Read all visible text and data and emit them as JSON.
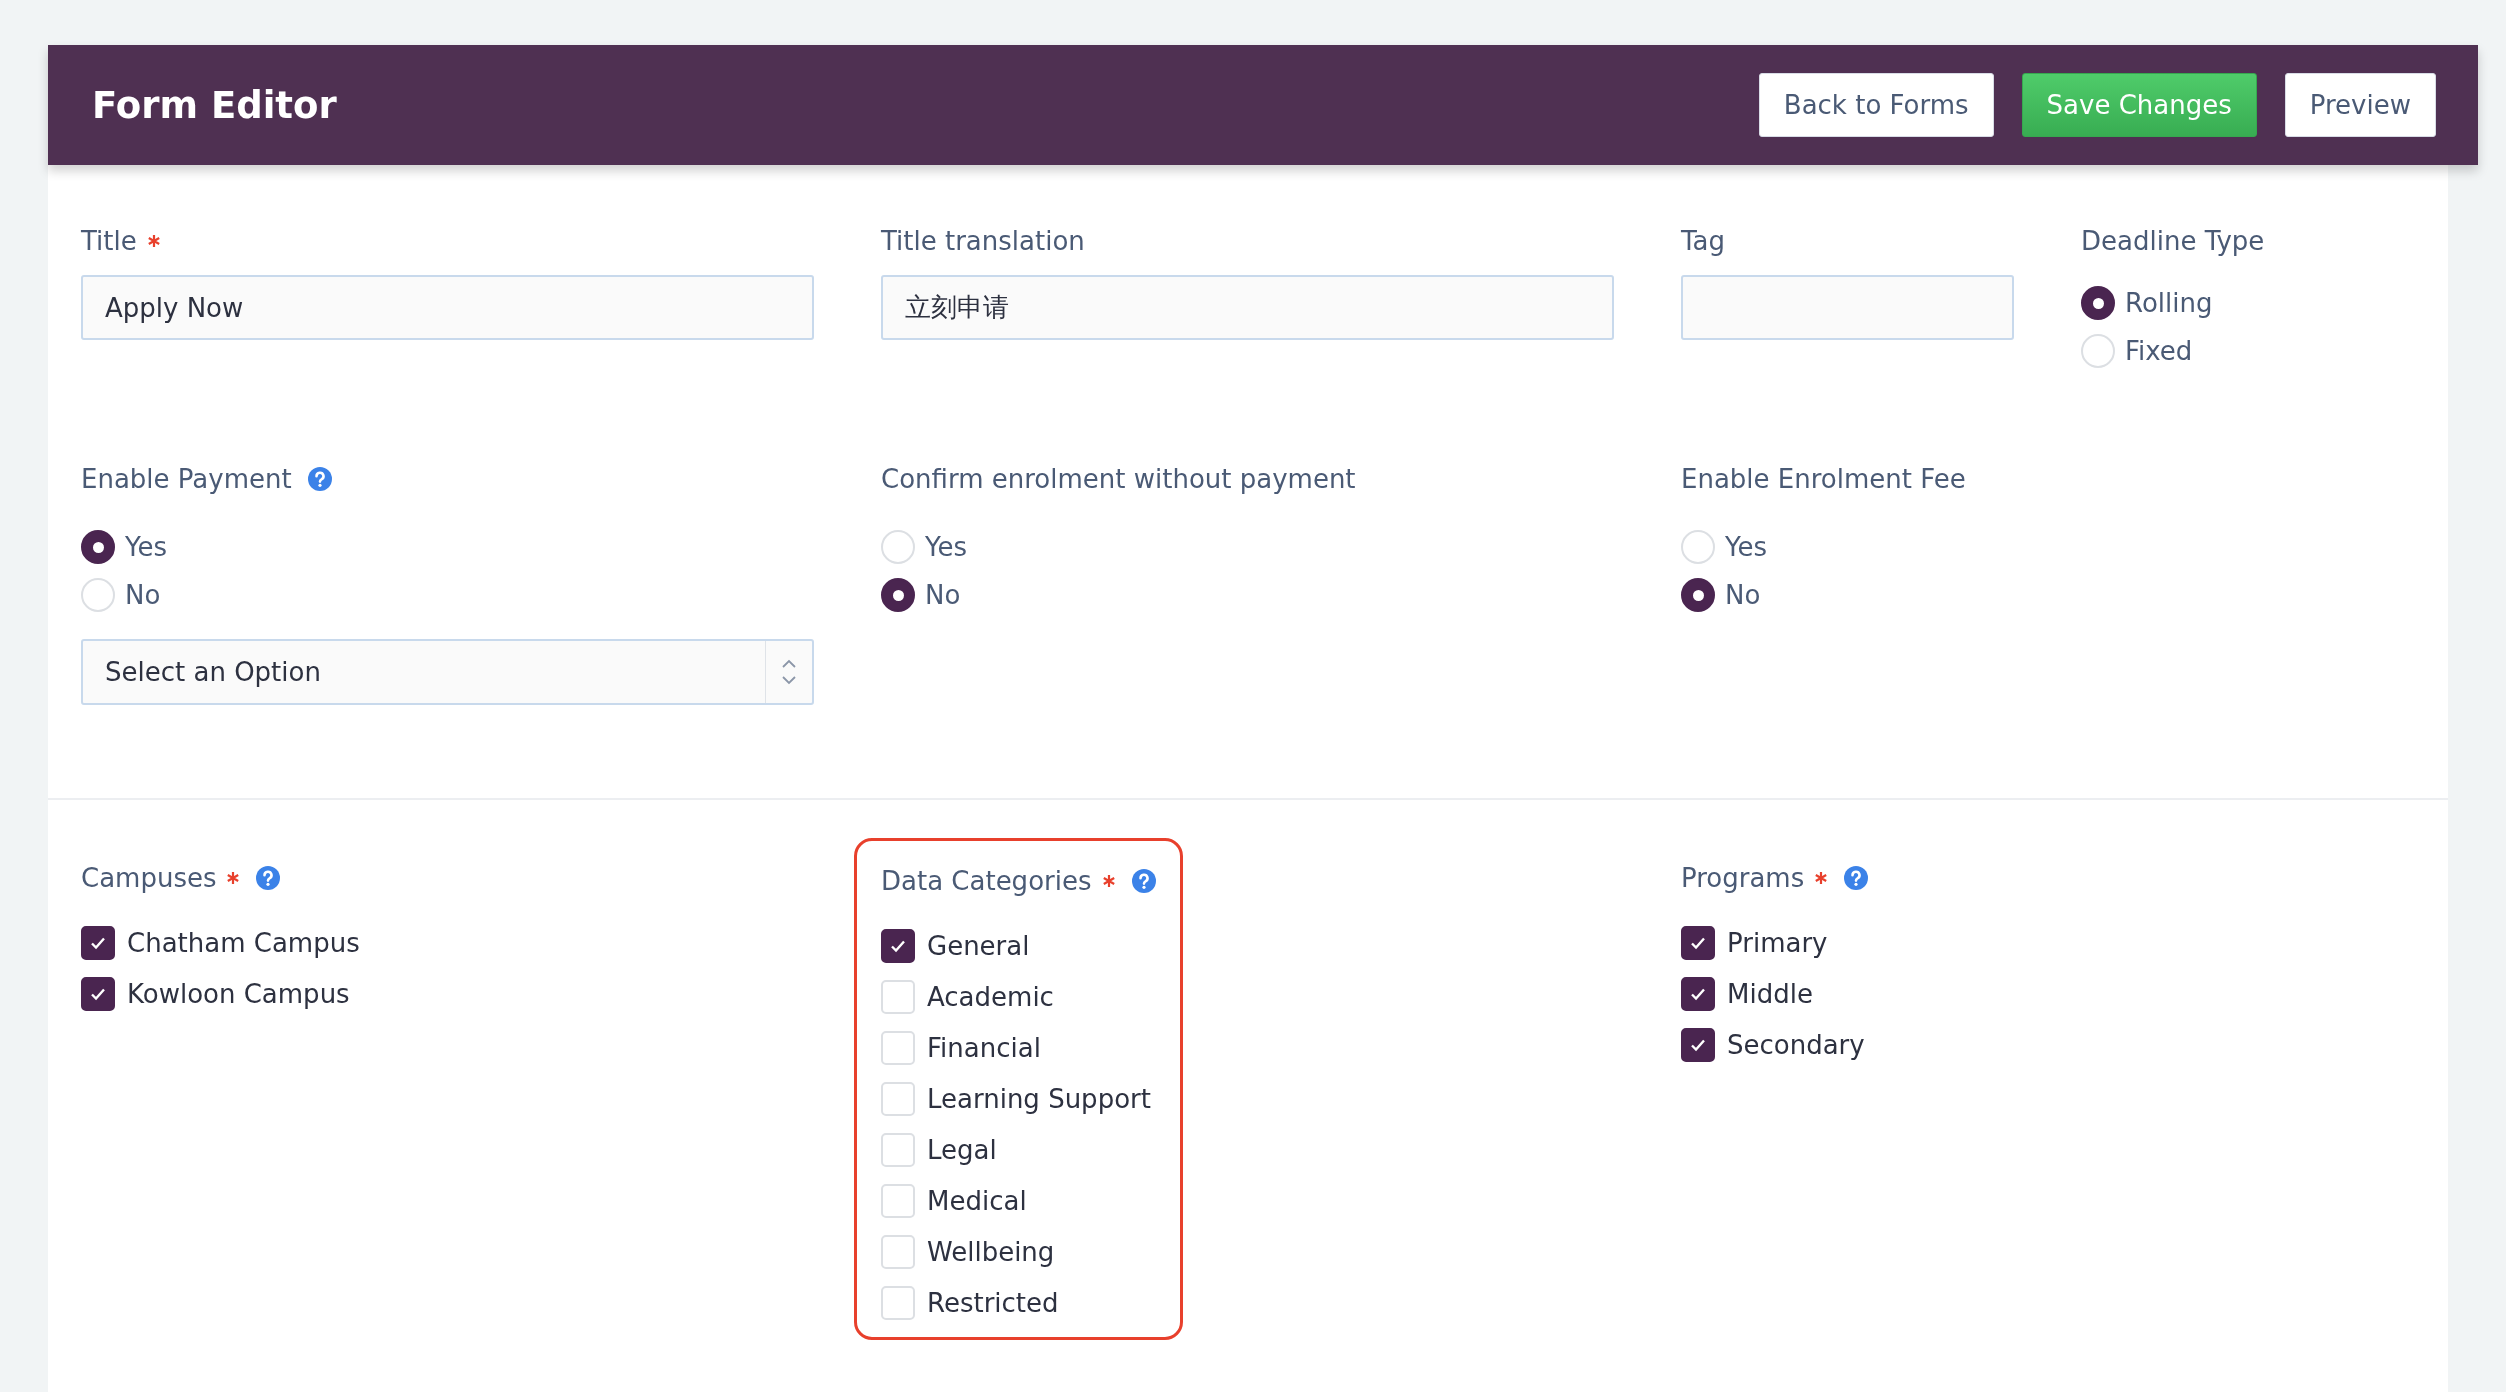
{
  "header": {
    "title": "Form Editor",
    "buttons": [
      {
        "label": "Back to Forms",
        "kind": "default"
      },
      {
        "label": "Save Changes",
        "kind": "primary"
      },
      {
        "label": "Preview",
        "kind": "default"
      }
    ]
  },
  "sections": [
    {
      "fields": [
        {
          "kind": "text",
          "label": "Title",
          "required": true,
          "value": "Apply Now"
        },
        {
          "kind": "text",
          "label": "Title translation",
          "value": "立刻申请"
        },
        {
          "kind": "text",
          "label": "Tag"
        },
        {
          "kind": "radio",
          "label": "Deadline Type",
          "options": [
            {
              "label": "Rolling",
              "selected": true
            },
            {
              "label": "Fixed",
              "selected": false
            }
          ]
        }
      ]
    },
    {
      "fields": [
        {
          "kind": "radio",
          "label": "Enable Payment",
          "help": true,
          "options": [
            {
              "label": "Yes",
              "selected": true
            },
            {
              "label": "No",
              "selected": false
            }
          ],
          "select": {
            "value": "Select an Option"
          }
        },
        {
          "kind": "radio",
          "label": "Confirm enrolment without payment",
          "options": [
            {
              "label": "Yes",
              "selected": false
            },
            {
              "label": "No",
              "selected": true
            }
          ]
        },
        {
          "kind": "radio",
          "label": "Enable Enrolment Fee",
          "options": [
            {
              "label": "Yes",
              "selected": false
            },
            {
              "label": "No",
              "selected": true
            }
          ]
        }
      ]
    },
    {
      "fields": [
        {
          "kind": "checkboxes",
          "label": "Campuses",
          "required": true,
          "help": true,
          "options": [
            {
              "label": "Chatham Campus",
              "checked": true
            },
            {
              "label": "Kowloon Campus",
              "checked": true
            }
          ]
        },
        {
          "kind": "checkboxes",
          "label": "Data Categories",
          "required": true,
          "help": true,
          "highlighted": true,
          "options": [
            {
              "label": "General",
              "checked": true
            },
            {
              "label": "Academic",
              "checked": false
            },
            {
              "label": "Financial",
              "checked": false
            },
            {
              "label": "Learning Support",
              "checked": false
            },
            {
              "label": "Legal",
              "checked": false
            },
            {
              "label": "Medical",
              "checked": false
            },
            {
              "label": "Wellbeing",
              "checked": false
            },
            {
              "label": "Restricted",
              "checked": false
            }
          ]
        },
        {
          "kind": "checkboxes",
          "label": "Programs",
          "required": true,
          "help": true,
          "options": [
            {
              "label": "Primary",
              "checked": true
            },
            {
              "label": "Middle",
              "checked": true
            },
            {
              "label": "Secondary",
              "checked": true
            }
          ]
        }
      ]
    }
  ]
}
